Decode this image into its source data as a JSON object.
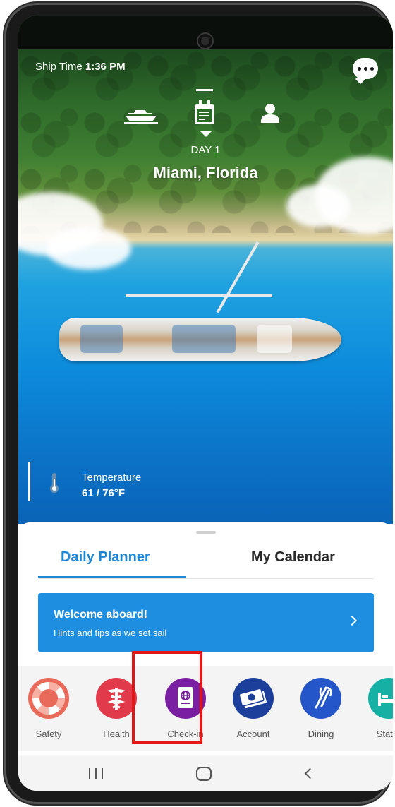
{
  "status": {
    "ship_time_label": "Ship Time",
    "ship_time_value": "1:36 PM"
  },
  "hero": {
    "day_label": "DAY 1",
    "port_name": "Miami, Florida",
    "temperature_label": "Temperature",
    "temperature_value": "61 / 76°F"
  },
  "top_nav": {
    "icons": [
      "ship-icon",
      "calendar-icon",
      "person-icon"
    ]
  },
  "tabs": [
    {
      "label": "Daily Planner",
      "active": true
    },
    {
      "label": "My Calendar",
      "active": false
    }
  ],
  "welcome_card": {
    "title": "Welcome aboard!",
    "subtitle": "Hints and tips as we set sail"
  },
  "quick_actions": [
    {
      "label": "Safety",
      "icon": "life-ring-icon",
      "color": "#e96a5a"
    },
    {
      "label": "Health",
      "icon": "caduceus-icon",
      "color": "#e03a4b"
    },
    {
      "label": "Check-in",
      "icon": "passport-icon",
      "color": "#7b1fa2"
    },
    {
      "label": "Account",
      "icon": "money-icon",
      "color": "#1c3f9c"
    },
    {
      "label": "Dining",
      "icon": "fork-knife-icon",
      "color": "#2456c9"
    },
    {
      "label": "Stater",
      "icon": "bed-icon",
      "color": "#17b0a4"
    }
  ],
  "colors": {
    "accent": "#1e88d6",
    "card": "#1e8fe0",
    "highlight": "#e31515"
  }
}
